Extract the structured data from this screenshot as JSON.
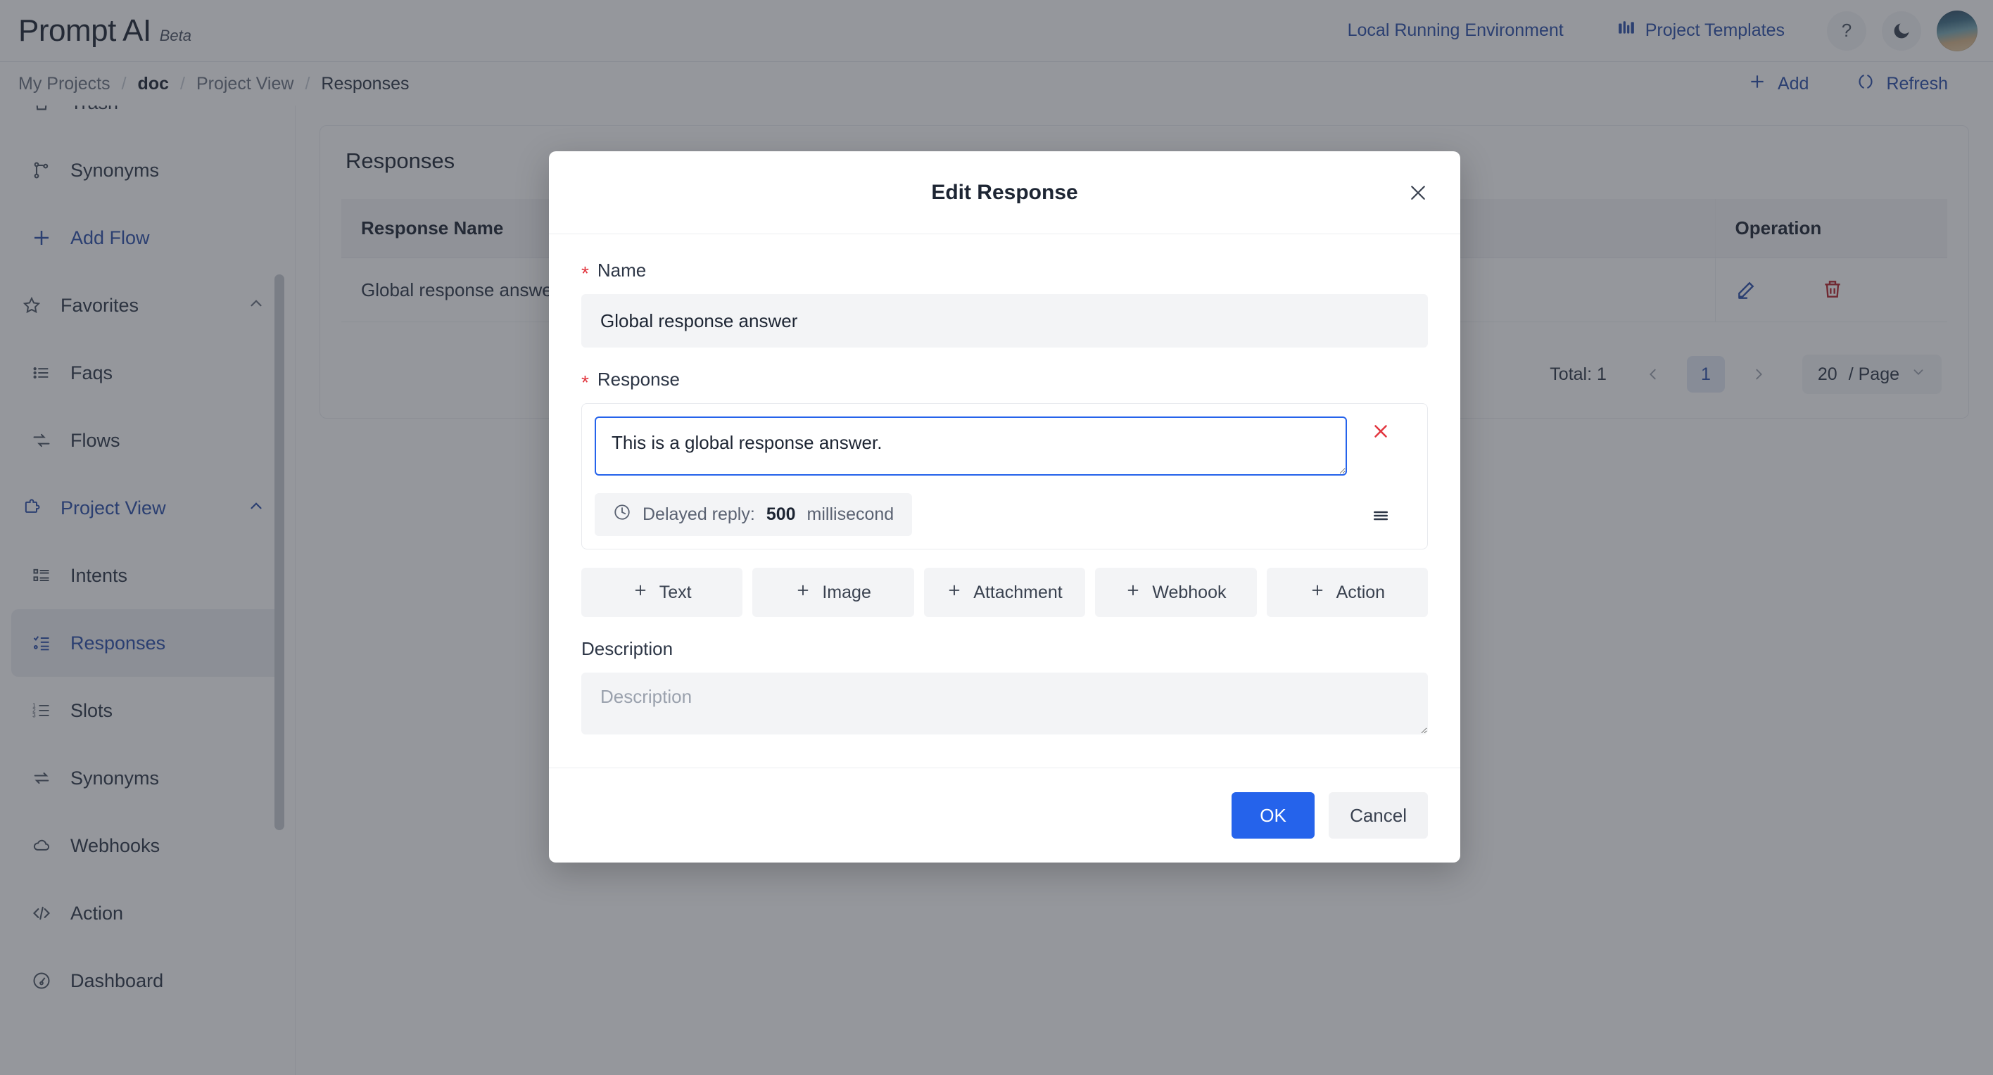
{
  "header": {
    "brand_name": "Prompt AI",
    "brand_tag": "Beta",
    "env_link": "Local Running Environment",
    "templates_link": "Project Templates",
    "help_icon": "question-mark-icon",
    "theme_icon": "moon-icon",
    "avatar": "user-avatar"
  },
  "breadcrumb": {
    "items": [
      "My Projects",
      "doc",
      "Project View",
      "Responses"
    ],
    "separator": "/",
    "add_label": "Add",
    "refresh_label": "Refresh"
  },
  "sidebar": {
    "items": [
      {
        "label": "Trash",
        "icon": "trash-icon",
        "type": "item",
        "state": "normal"
      },
      {
        "label": "Synonyms",
        "icon": "branch-icon",
        "type": "item",
        "state": "normal"
      },
      {
        "label": "Add Flow",
        "icon": "plus-icon",
        "type": "item",
        "state": "accent"
      },
      {
        "label": "Favorites",
        "icon": "star-icon",
        "type": "group",
        "state": "normal",
        "expanded": true
      },
      {
        "label": "Faqs",
        "icon": "list-icon",
        "type": "item",
        "state": "normal"
      },
      {
        "label": "Flows",
        "icon": "flow-icon",
        "type": "item",
        "state": "normal"
      },
      {
        "label": "Project View",
        "icon": "puzzle-icon",
        "type": "group",
        "state": "accent",
        "expanded": true
      },
      {
        "label": "Intents",
        "icon": "intents-list-icon",
        "type": "item",
        "state": "normal"
      },
      {
        "label": "Responses",
        "icon": "responses-list-icon",
        "type": "item",
        "state": "active"
      },
      {
        "label": "Slots",
        "icon": "numbered-list-icon",
        "type": "item",
        "state": "normal"
      },
      {
        "label": "Synonyms",
        "icon": "swap-icon",
        "type": "item",
        "state": "normal"
      },
      {
        "label": "Webhooks",
        "icon": "cloud-icon",
        "type": "item",
        "state": "normal"
      },
      {
        "label": "Action",
        "icon": "code-icon",
        "type": "item",
        "state": "normal"
      },
      {
        "label": "Dashboard",
        "icon": "dashboard-icon",
        "type": "item",
        "state": "normal"
      }
    ]
  },
  "main": {
    "panel_title": "Responses",
    "table": {
      "columns": [
        "Response Name",
        "Operation"
      ],
      "rows": [
        {
          "name": "Global response answer",
          "edit_icon": "pencil-icon",
          "delete_icon": "trash-icon"
        }
      ]
    },
    "pagination": {
      "total_label": "Total: 1",
      "prev_icon": "chevron-left-icon",
      "next_icon": "chevron-right-icon",
      "current_page": "1",
      "page_size": "20",
      "page_size_suffix": "/ Page",
      "dropdown_icon": "chevron-down-icon"
    }
  },
  "modal": {
    "title": "Edit Response",
    "close_icon": "close-icon",
    "name": {
      "label": "Name",
      "required_mark": "*",
      "value": "Global response answer"
    },
    "response": {
      "label": "Response",
      "required_mark": "*",
      "text_value": "This is a global response answer.",
      "delay": {
        "clock_icon": "clock-icon",
        "label": "Delayed reply:",
        "value": "500",
        "unit": "millisecond"
      },
      "remove_icon": "close-red-icon",
      "drag_icon": "drag-handle-icon"
    },
    "add_buttons": [
      {
        "label": "Text",
        "icon": "plus-icon"
      },
      {
        "label": "Image",
        "icon": "plus-icon"
      },
      {
        "label": "Attachment",
        "icon": "plus-icon"
      },
      {
        "label": "Webhook",
        "icon": "plus-icon"
      },
      {
        "label": "Action",
        "icon": "plus-icon"
      }
    ],
    "description": {
      "label": "Description",
      "placeholder": "Description",
      "value": ""
    },
    "footer": {
      "ok_label": "OK",
      "cancel_label": "Cancel"
    }
  },
  "colors": {
    "accent_blue": "#2563eb",
    "link_blue": "#2a4ea8",
    "danger_red": "#e2363f",
    "delete_red": "#b4232b",
    "panel_gray": "#f3f4f6"
  }
}
